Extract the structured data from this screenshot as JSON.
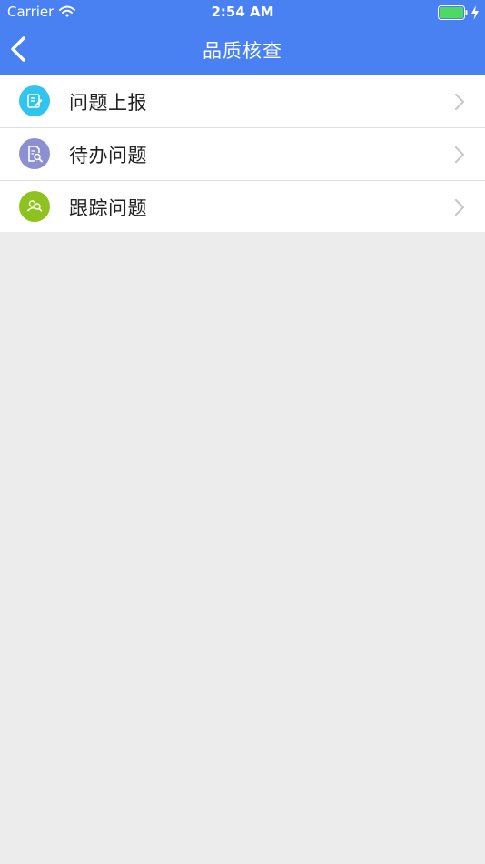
{
  "status_bar": {
    "carrier": "Carrier",
    "time": "2:54 AM",
    "battery_color": "#4cd964"
  },
  "nav": {
    "title": "品质核查",
    "back_icon": "chevron-left-icon",
    "color": "#4a81f2"
  },
  "menu": {
    "items": [
      {
        "label": "问题上报",
        "icon": "edit-note-icon",
        "icon_bg": "#2fc5f0"
      },
      {
        "label": "待办问题",
        "icon": "document-search-icon",
        "icon_bg": "#8c8fd0"
      },
      {
        "label": "跟踪问题",
        "icon": "people-search-icon",
        "icon_bg": "#8ec21f"
      }
    ]
  }
}
